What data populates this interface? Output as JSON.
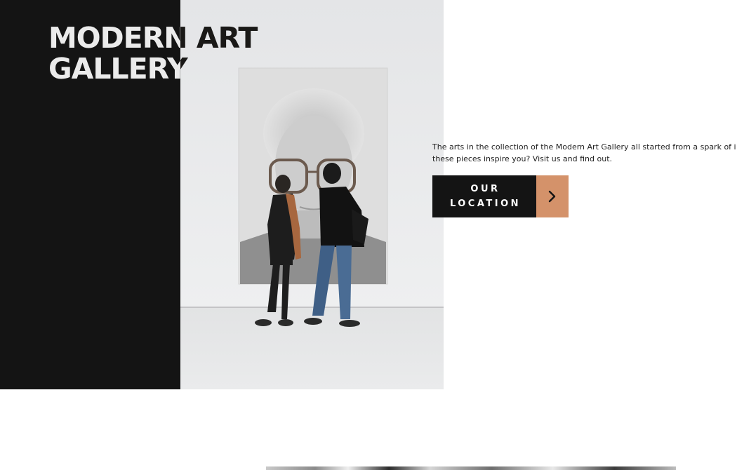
{
  "hero": {
    "title_line1": "MODERN ART",
    "title_line2": "GALLERY",
    "description": "The arts in the collection of the Modern Art Gallery all started from a spark of i these pieces inspire you? Visit us and find out.",
    "cta_label": "OUR\nLOCATION",
    "cta_icon": "chevron-right-icon"
  },
  "colors": {
    "dark": "#141414",
    "accent": "#d4926a",
    "background": "#ffffff"
  }
}
